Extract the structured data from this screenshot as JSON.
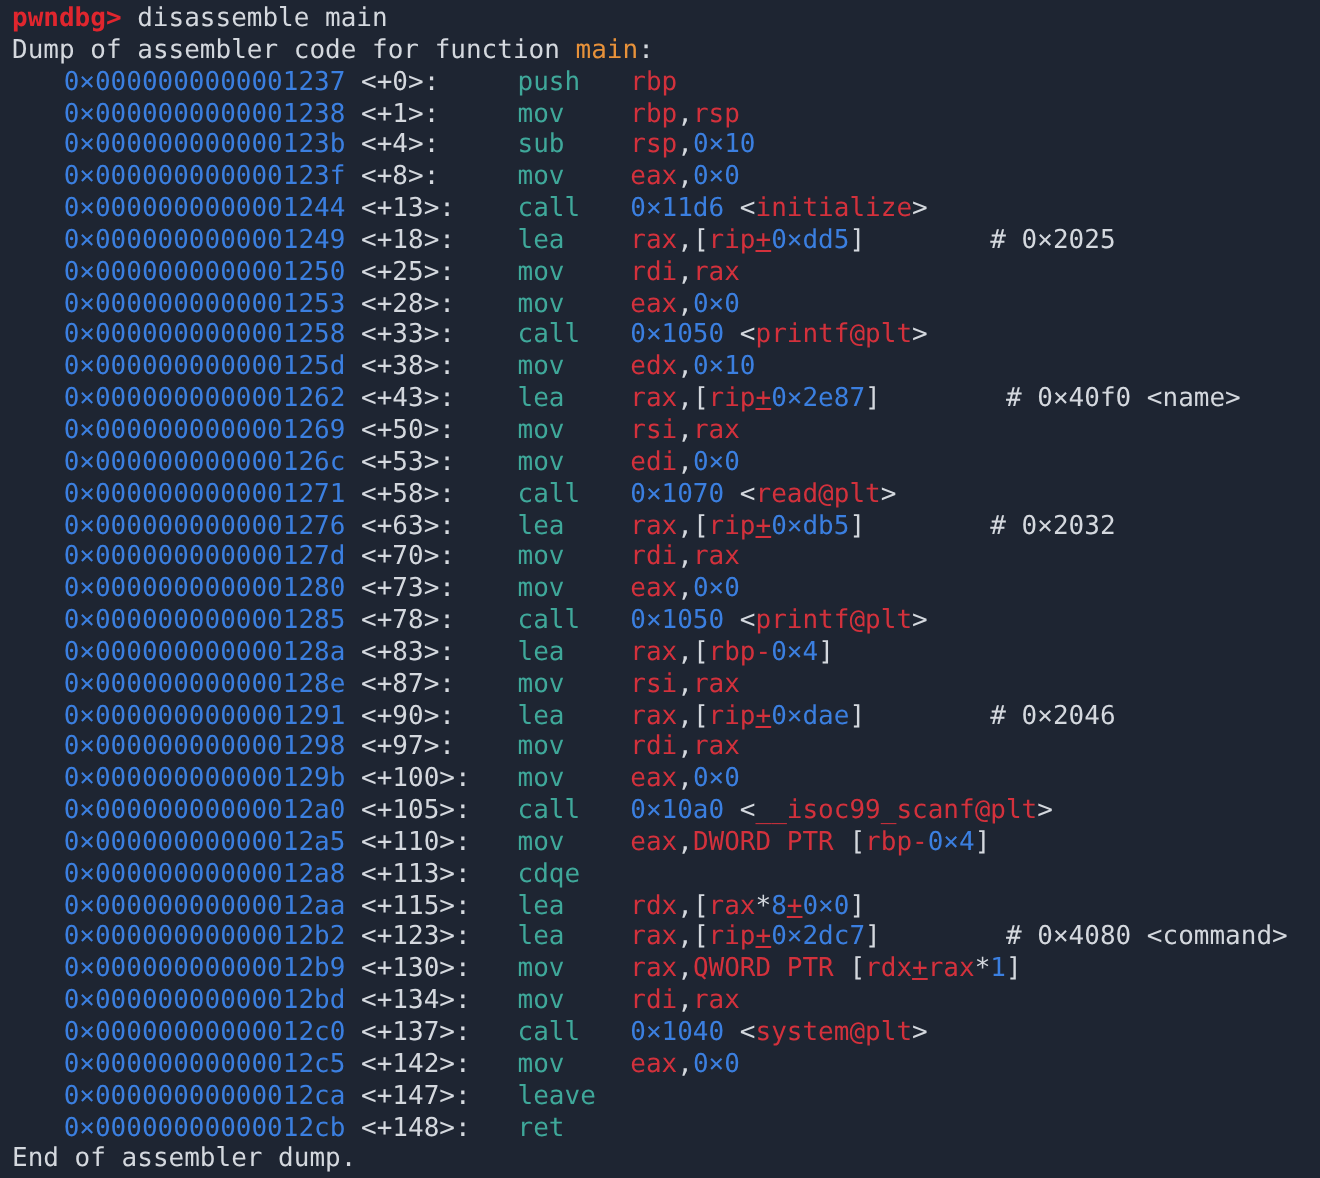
{
  "prompt": {
    "label": "pwndbg>",
    "command": "disassemble main"
  },
  "dump_header": {
    "text": "Dump of assembler code for function",
    "function": "main",
    "suffix": ":"
  },
  "instructions": [
    {
      "address": "0×0000000000001237",
      "offset": "<+0>:",
      "mnemonic": "push",
      "operands": "rbp"
    },
    {
      "address": "0×0000000000001238",
      "offset": "<+1>:",
      "mnemonic": "mov",
      "operands": "rbp,rsp"
    },
    {
      "address": "0×000000000000123b",
      "offset": "<+4>:",
      "mnemonic": "sub",
      "operands": "rsp,0×10"
    },
    {
      "address": "0×000000000000123f",
      "offset": "<+8>:",
      "mnemonic": "mov",
      "operands": "eax,0×0"
    },
    {
      "address": "0×0000000000001244",
      "offset": "<+13>:",
      "mnemonic": "call",
      "operands": "0×11d6 <initialize>"
    },
    {
      "address": "0×0000000000001249",
      "offset": "<+18>:",
      "mnemonic": "lea",
      "operands": "rax,[rip+0×dd5]",
      "comment": "# 0×2025"
    },
    {
      "address": "0×0000000000001250",
      "offset": "<+25>:",
      "mnemonic": "mov",
      "operands": "rdi,rax"
    },
    {
      "address": "0×0000000000001253",
      "offset": "<+28>:",
      "mnemonic": "mov",
      "operands": "eax,0×0"
    },
    {
      "address": "0×0000000000001258",
      "offset": "<+33>:",
      "mnemonic": "call",
      "operands": "0×1050 <printf@plt>"
    },
    {
      "address": "0×000000000000125d",
      "offset": "<+38>:",
      "mnemonic": "mov",
      "operands": "edx,0×10"
    },
    {
      "address": "0×0000000000001262",
      "offset": "<+43>:",
      "mnemonic": "lea",
      "operands": "rax,[rip+0×2e87]",
      "comment": "# 0×40f0 <name>"
    },
    {
      "address": "0×0000000000001269",
      "offset": "<+50>:",
      "mnemonic": "mov",
      "operands": "rsi,rax"
    },
    {
      "address": "0×000000000000126c",
      "offset": "<+53>:",
      "mnemonic": "mov",
      "operands": "edi,0×0"
    },
    {
      "address": "0×0000000000001271",
      "offset": "<+58>:",
      "mnemonic": "call",
      "operands": "0×1070 <read@plt>"
    },
    {
      "address": "0×0000000000001276",
      "offset": "<+63>:",
      "mnemonic": "lea",
      "operands": "rax,[rip+0×db5]",
      "comment": "# 0×2032"
    },
    {
      "address": "0×000000000000127d",
      "offset": "<+70>:",
      "mnemonic": "mov",
      "operands": "rdi,rax"
    },
    {
      "address": "0×0000000000001280",
      "offset": "<+73>:",
      "mnemonic": "mov",
      "operands": "eax,0×0"
    },
    {
      "address": "0×0000000000001285",
      "offset": "<+78>:",
      "mnemonic": "call",
      "operands": "0×1050 <printf@plt>"
    },
    {
      "address": "0×000000000000128a",
      "offset": "<+83>:",
      "mnemonic": "lea",
      "operands": "rax,[rbp-0×4]"
    },
    {
      "address": "0×000000000000128e",
      "offset": "<+87>:",
      "mnemonic": "mov",
      "operands": "rsi,rax"
    },
    {
      "address": "0×0000000000001291",
      "offset": "<+90>:",
      "mnemonic": "lea",
      "operands": "rax,[rip+0×dae]",
      "comment": "# 0×2046"
    },
    {
      "address": "0×0000000000001298",
      "offset": "<+97>:",
      "mnemonic": "mov",
      "operands": "rdi,rax"
    },
    {
      "address": "0×000000000000129b",
      "offset": "<+100>:",
      "mnemonic": "mov",
      "operands": "eax,0×0"
    },
    {
      "address": "0×00000000000012a0",
      "offset": "<+105>:",
      "mnemonic": "call",
      "operands": "0×10a0 <__isoc99_scanf@plt>"
    },
    {
      "address": "0×00000000000012a5",
      "offset": "<+110>:",
      "mnemonic": "mov",
      "operands": "eax,DWORD PTR [rbp-0×4]"
    },
    {
      "address": "0×00000000000012a8",
      "offset": "<+113>:",
      "mnemonic": "cdqe"
    },
    {
      "address": "0×00000000000012aa",
      "offset": "<+115>:",
      "mnemonic": "lea",
      "operands": "rdx,[rax*8+0×0]"
    },
    {
      "address": "0×00000000000012b2",
      "offset": "<+123>:",
      "mnemonic": "lea",
      "operands": "rax,[rip+0×2dc7]",
      "comment": "# 0×4080 <command>"
    },
    {
      "address": "0×00000000000012b9",
      "offset": "<+130>:",
      "mnemonic": "mov",
      "operands": "rax,QWORD PTR [rdx+rax*1]"
    },
    {
      "address": "0×00000000000012bd",
      "offset": "<+134>:",
      "mnemonic": "mov",
      "operands": "rdi,rax"
    },
    {
      "address": "0×00000000000012c0",
      "offset": "<+137>:",
      "mnemonic": "call",
      "operands": "0×1040 <system@plt>"
    },
    {
      "address": "0×00000000000012c5",
      "offset": "<+142>:",
      "mnemonic": "mov",
      "operands": "eax,0×0"
    },
    {
      "address": "0×00000000000012ca",
      "offset": "<+147>:",
      "mnemonic": "leave"
    },
    {
      "address": "0×00000000000012cb",
      "offset": "<+148>:",
      "mnemonic": "ret"
    }
  ],
  "footer": "End of assembler dump."
}
